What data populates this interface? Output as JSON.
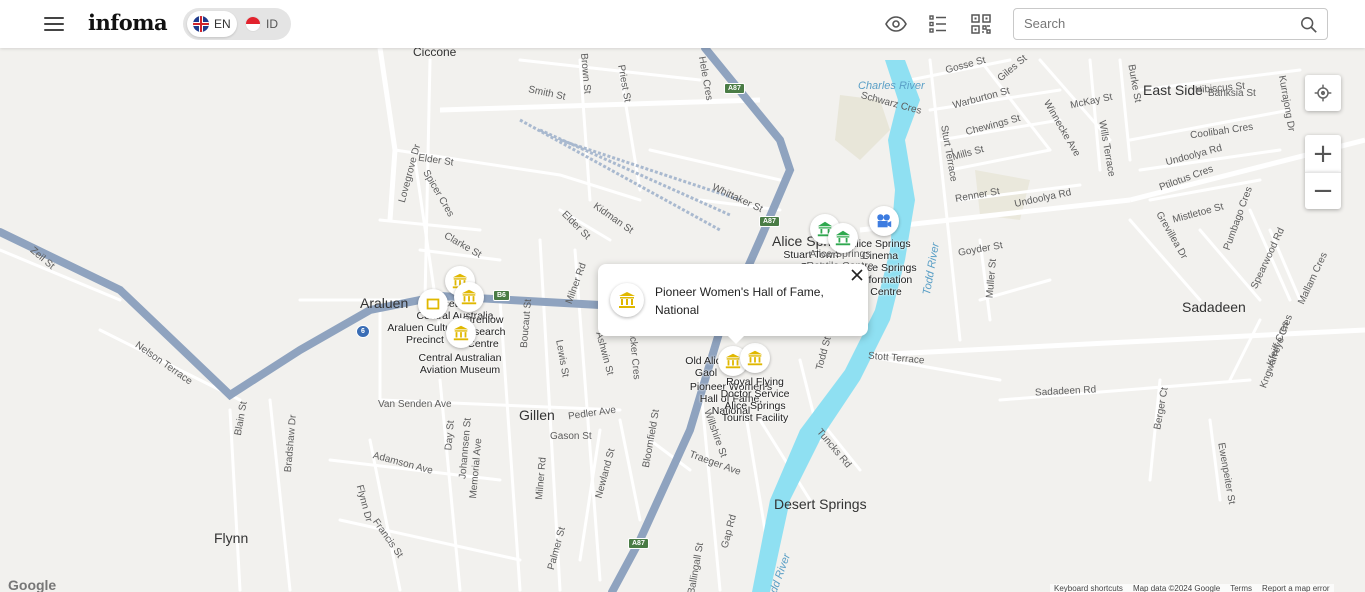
{
  "header": {
    "logo": "infoma",
    "languages": [
      {
        "code": "EN",
        "flag": "uk-flag-icon",
        "active": true
      },
      {
        "code": "ID",
        "flag": "indonesia-flag-icon",
        "active": false
      }
    ],
    "search_placeholder": "Search"
  },
  "popup": {
    "title": "Pioneer Women's Hall of Fame, National",
    "icon": "museum-icon"
  },
  "map_labels": {
    "suburbs": [
      "Araluen",
      "Gillen",
      "Flynn",
      "Desert Springs",
      "East Side",
      "Sadadeen"
    ],
    "areas": [
      "Ciccone",
      "Alice Springs"
    ],
    "rivers": [
      "Charles River",
      "Todd River"
    ],
    "streets": [
      "Smith St",
      "Brown St",
      "Priest St",
      "Hele Cres",
      "Elder St",
      "Lovegrove Dr",
      "Spicer Cres",
      "Clarke St",
      "Kidman St",
      "Whittaker St",
      "Elder St",
      "Milner Rd",
      "Boucaut St",
      "Lewis St",
      "Ashwin St",
      "Hicker Cres",
      "Pedler Ave",
      "Van Senden Ave",
      "Gason St",
      "Day St",
      "Johannsen St",
      "Memorial Ave",
      "Adamson Ave",
      "Bradshaw Dr",
      "Blain St",
      "Nelson Terrace",
      "Zeil St",
      "Flynn Dr",
      "Francis St",
      "Newland St",
      "Bloomfield St",
      "Milner Rd",
      "Palmer St",
      "Willshire St",
      "Traeger Ave",
      "Gap Rd",
      "Ballingall St",
      "Todd St",
      "Tuncks Rd",
      "Stott Terrace",
      "Sturt Terrace",
      "Gosse St",
      "Giles St",
      "Warburton St",
      "Chewings St",
      "Mills St",
      "Renner St",
      "Goyder St",
      "Muller St",
      "Undoolya Rd",
      "Undoolya Rd",
      "Coolibah Cres",
      "Ptilotus Cres",
      "Mistletoe St",
      "Grevillea Dr",
      "Pumbago Cres",
      "Spearwood Rd",
      "Mallam Cres",
      "Kurrajong Dr",
      "Hibiscus St",
      "Banksia St",
      "Burke St",
      "McKay St",
      "Wills Terrace",
      "Winnecke Ave",
      "Schwarz Cres",
      "Sadadeen Rd",
      "Berger Ct",
      "Kngwarreye Cres",
      "Kfeiff Cres",
      "Ewenpeiter St"
    ],
    "highways": [
      "A87",
      "A87",
      "B6",
      "6",
      "A87"
    ],
    "pois": [
      "Museum of Central Australia",
      "Strehlow Research Centre",
      "Araluen Cultural Precinct",
      "Central Australian Aviation Museum",
      "Old Alice Gaol",
      "Pioneer Women's Hall of Fame, National",
      "Royal Flying Doctor Service Alice Springs Tourist Facility",
      "Stuart Town Gaol",
      "Alice Springs Cinema",
      "Alice Springs Information Centre",
      "Alice Springs Reptile Centre"
    ]
  },
  "controls": {
    "zoom_in": "+",
    "zoom_out": "−"
  },
  "footer": {
    "google": "Google",
    "shortcuts": "Keyboard shortcuts",
    "map_data": "Map data ©2024 Google",
    "terms": "Terms",
    "report": "Report a map error"
  },
  "colors": {
    "museum_marker": "#e0b800",
    "park_marker": "#2fa84f",
    "cinema_marker": "#3d7ce0",
    "river": "#8fe0f2",
    "highway": "#8fa3bf"
  }
}
